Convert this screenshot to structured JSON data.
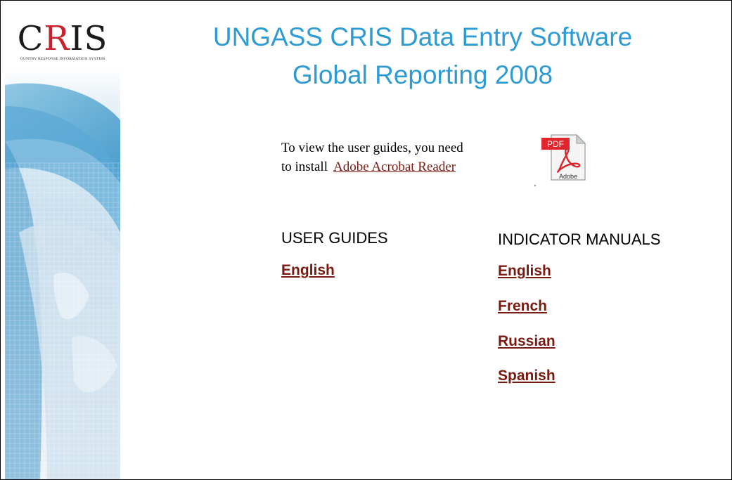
{
  "logo": {
    "mark_prefix": "C",
    "mark_accent": "R",
    "mark_suffix": "IS",
    "subtitle": "OUNTRY RESPONSE INFORMATION SYSTEM"
  },
  "header": {
    "title_line1": "UNGASS CRIS Data Entry Software",
    "title_line2": "Global Reporting 2008"
  },
  "install": {
    "line1": "To view the user guides, you need",
    "line2_prefix": "to install",
    "link_label": "Adobe Acrobat Reader",
    "icon": "pdf-adobe-icon",
    "icon_badge": "PDF",
    "icon_caption": "Adobe"
  },
  "user_guides": {
    "heading": "USER GUIDES",
    "links": [
      "English"
    ]
  },
  "indicator_manuals": {
    "heading": "INDICATOR MANUALS",
    "links": [
      "English",
      "French",
      "Russian",
      "Spanish"
    ]
  },
  "colors": {
    "title": "#2e9bd3",
    "link": "#7a1a10",
    "logo_accent": "#c8232c"
  }
}
